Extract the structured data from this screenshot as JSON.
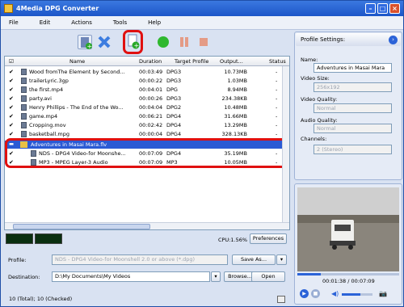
{
  "window": {
    "title": "4Media DPG Converter"
  },
  "menu": [
    "File",
    "Edit",
    "Actions",
    "Tools",
    "Help"
  ],
  "toolbar": {
    "icons": [
      "add-video-icon",
      "remove-icon",
      "add-profile-icon",
      "convert-icon",
      "pause-icon",
      "stop-icon"
    ]
  },
  "table": {
    "headers": [
      "Name",
      "Duration",
      "Target Profile",
      "Output...",
      "Status"
    ],
    "rows": [
      {
        "name": "Wood fromThe Element by Second...",
        "duration": "00:03:49",
        "profile": "DPG3",
        "output": "10.73MB",
        "status": "-"
      },
      {
        "name": "trailerLyric.3gp",
        "duration": "00:00:22",
        "profile": "DPG3",
        "output": "1.03MB",
        "status": "-"
      },
      {
        "name": "the first.mp4",
        "duration": "00:04:01",
        "profile": "DPG",
        "output": "8.94MB",
        "status": "-"
      },
      {
        "name": "party.avi",
        "duration": "00:00:26",
        "profile": "DPG3",
        "output": "234.38KB",
        "status": "-"
      },
      {
        "name": "Henry Phillips - The End of the Wo...",
        "duration": "00:04:04",
        "profile": "DPG2",
        "output": "10.48MB",
        "status": "-"
      },
      {
        "name": "game.mp4",
        "duration": "00:06:21",
        "profile": "DPG4",
        "output": "31.66MB",
        "status": "-"
      },
      {
        "name": "Cropping.mov",
        "duration": "00:02:42",
        "profile": "DPG4",
        "output": "13.29MB",
        "status": "-"
      },
      {
        "name": "basketball.mpg",
        "duration": "00:00:04",
        "profile": "DPG4",
        "output": "328.13KB",
        "status": "-"
      }
    ],
    "group": {
      "name": "Adventures in Masai Mara.flv"
    },
    "children": [
      {
        "name": "NDS - DPG4 Video-for Moonshe...",
        "duration": "00:07:09",
        "profile": "DPG4",
        "output": "35.19MB",
        "status": "-"
      },
      {
        "name": "MP3 - MPEG Layer-3 Audio",
        "duration": "00:07:09",
        "profile": "MP3",
        "output": "10.05MB",
        "status": "-"
      }
    ]
  },
  "cpu": {
    "label": "CPU:1.56%",
    "preferences": "Preferences"
  },
  "profile": {
    "label": "Profile:",
    "value": "NDS - DPG4 Video-for Moonshell 2.0 or above (*.dpg)",
    "save_as": "Save As..."
  },
  "destination": {
    "label": "Destination:",
    "value": "D:\\My Documents\\My Videos",
    "browse": "Browse...",
    "open": "Open"
  },
  "status": {
    "text": "10 (Total); 10 (Checked)"
  },
  "settings": {
    "title": "Profile Settings:",
    "name_label": "Name:",
    "name_value": "Adventures in Masai Mara",
    "video_size_label": "Video Size:",
    "video_size_value": "256x192",
    "video_quality_label": "Video Quality:",
    "video_quality_value": "Normal",
    "audio_quality_label": "Audio Quality:",
    "audio_quality_value": "Normal",
    "channels_label": "Channels:",
    "channels_value": "2 (Stereo)"
  },
  "player": {
    "time": "00:01:38 / 00:07:09",
    "progress": 0.23,
    "volume": 0.6
  }
}
